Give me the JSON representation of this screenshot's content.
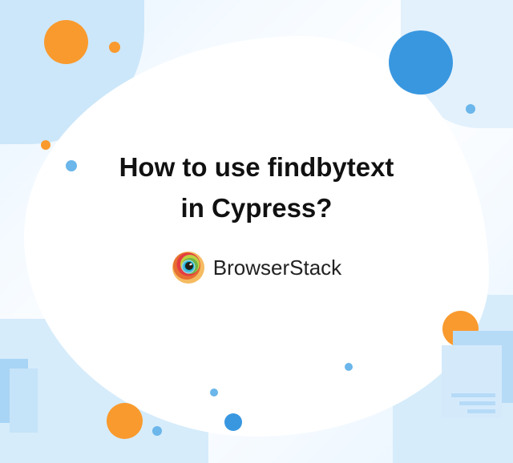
{
  "title_line1": "How to use findbytext",
  "title_line2": "in Cypress?",
  "brand": "BrowserStack"
}
